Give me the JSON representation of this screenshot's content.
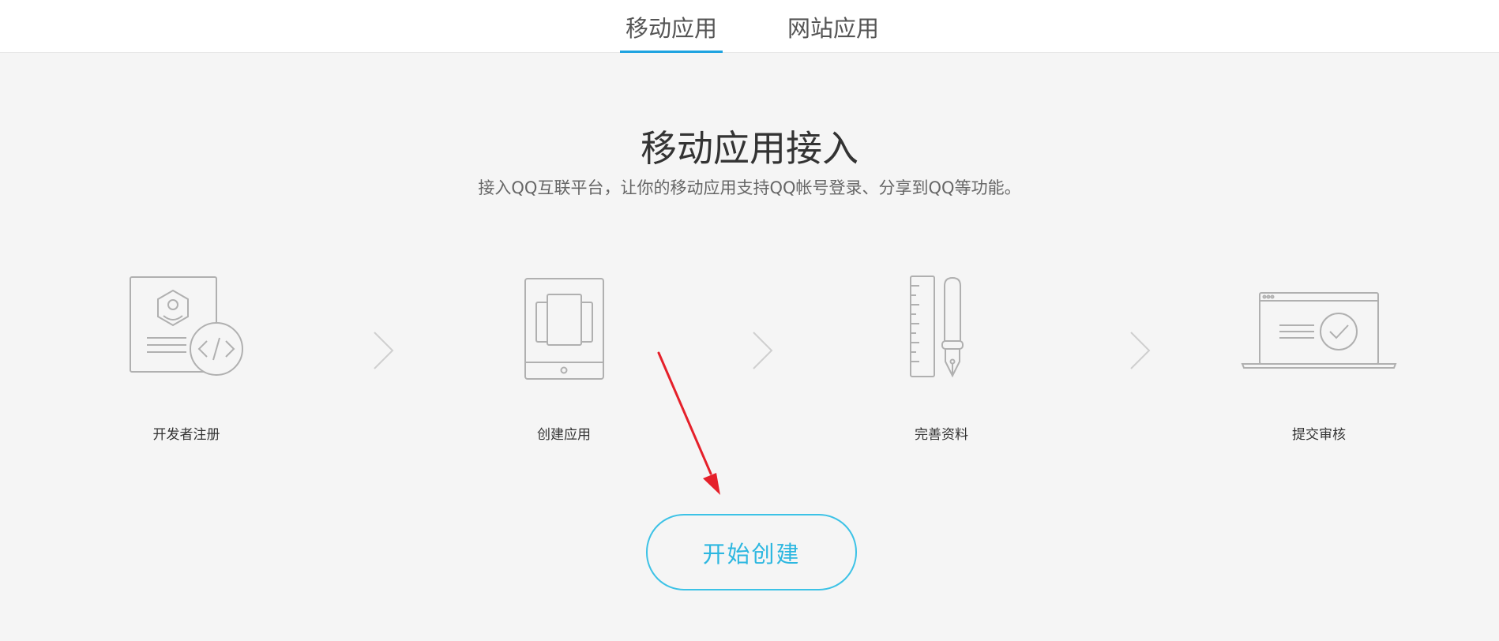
{
  "tabs": [
    {
      "label": "移动应用",
      "active": true
    },
    {
      "label": "网站应用",
      "active": false
    }
  ],
  "hero": {
    "title": "移动应用接入",
    "subtitle": "接入QQ互联平台，让你的移动应用支持QQ帐号登录、分享到QQ等功能。"
  },
  "steps": [
    {
      "label": "开发者注册",
      "icon": "developer-register-icon"
    },
    {
      "label": "创建应用",
      "icon": "tablet-icon"
    },
    {
      "label": "完善资料",
      "icon": "ruler-pen-icon"
    },
    {
      "label": "提交审核",
      "icon": "laptop-check-icon"
    }
  ],
  "start_button": {
    "label": "开始创建"
  },
  "colors": {
    "accent": "#1fa3e0",
    "button_border": "#3cc2e6",
    "annotation_arrow": "#e5202a",
    "icon_stroke": "#b0b0b0"
  }
}
